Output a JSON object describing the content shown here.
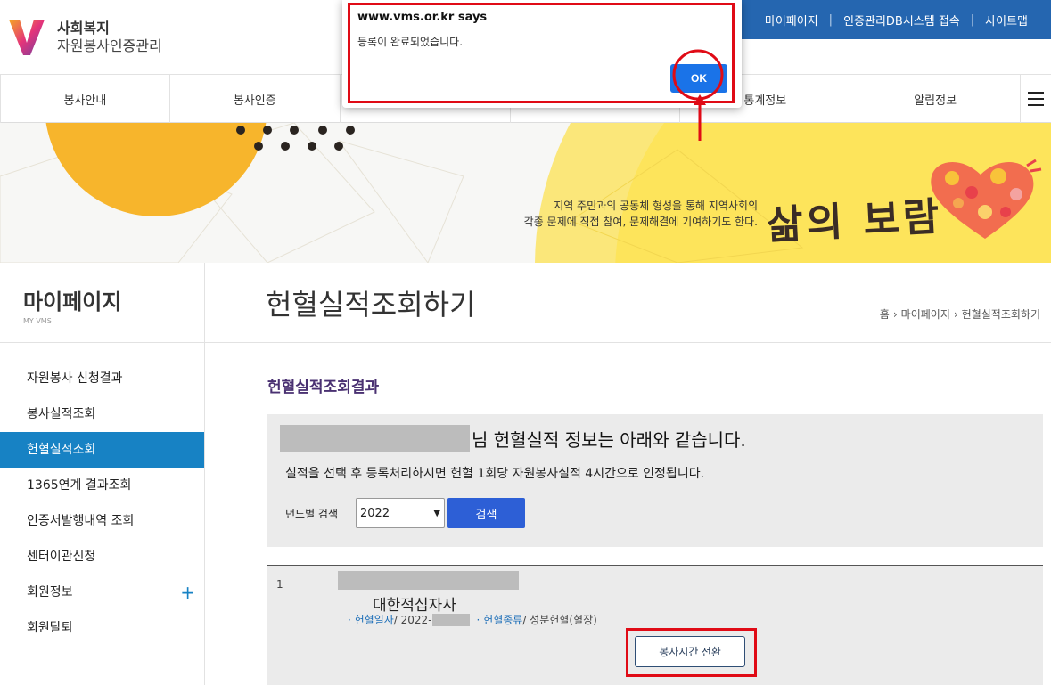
{
  "header": {
    "logo_line1": "사회복지",
    "logo_line2": "자원봉사인증관리",
    "util_links": [
      "마이페이지",
      "인증관리DB시스템 접속",
      "사이트맵"
    ]
  },
  "gnb": {
    "items": [
      "봉사안내",
      "봉사인증",
      "",
      "",
      "통계정보",
      "알림정보"
    ],
    "menu_icon": "hamburger-icon"
  },
  "banner": {
    "text_line1": "지역 주민과의 공동체 형성을 통해 지역사회의",
    "text_line2": "각종 문제에 직접 참여, 문제해결에 기여하기도 한다.",
    "slogan": "삶의 보람"
  },
  "side": {
    "title": "마이페이지",
    "subtitle": "MY VMS",
    "items": [
      {
        "label": "자원봉사 신청결과"
      },
      {
        "label": "봉사실적조회"
      },
      {
        "label": "헌혈실적조회",
        "active": true
      },
      {
        "label": "1365연계 결과조회"
      },
      {
        "label": "인증서발행내역 조회"
      },
      {
        "label": "센터이관신청"
      },
      {
        "label": "회원정보",
        "expand_icon": "plus-icon"
      },
      {
        "label": "회원탈퇴"
      }
    ]
  },
  "main": {
    "page_title": "헌혈실적조회하기",
    "breadcrumb": [
      "홈",
      "마이페이지",
      "헌혈실적조회하기"
    ],
    "section_title": "헌혈실적조회결과",
    "info_heading_suffix": "님 헌혈실적 정보는 아래와 같습니다.",
    "info_note": "실적을 선택 후 등록처리하시면 헌혈 1회당 자원봉사실적 4시간으로 인정됩니다.",
    "search_label": "년도별 검색",
    "year_selected": "2022",
    "search_button": "검색",
    "results": [
      {
        "num": "1",
        "org": "대한적십자사",
        "date_key": "· 헌혈일자",
        "date_value": "/ 2022-",
        "type_key": "· 헌혈종류",
        "type_value": "/ 성분헌혈(혈장)",
        "action": "봉사시간 전환"
      }
    ]
  },
  "dialog": {
    "title": "www.vms.or.kr says",
    "message": "등록이 완료되었습니다.",
    "ok_label": "OK"
  },
  "colors": {
    "util_bar": "#2566b0",
    "side_active": "#1782c4",
    "section_title": "#4a3172",
    "search_button": "#2d5fd6",
    "highlight": "#e00b16",
    "dialog_ok": "#1a73e8"
  }
}
